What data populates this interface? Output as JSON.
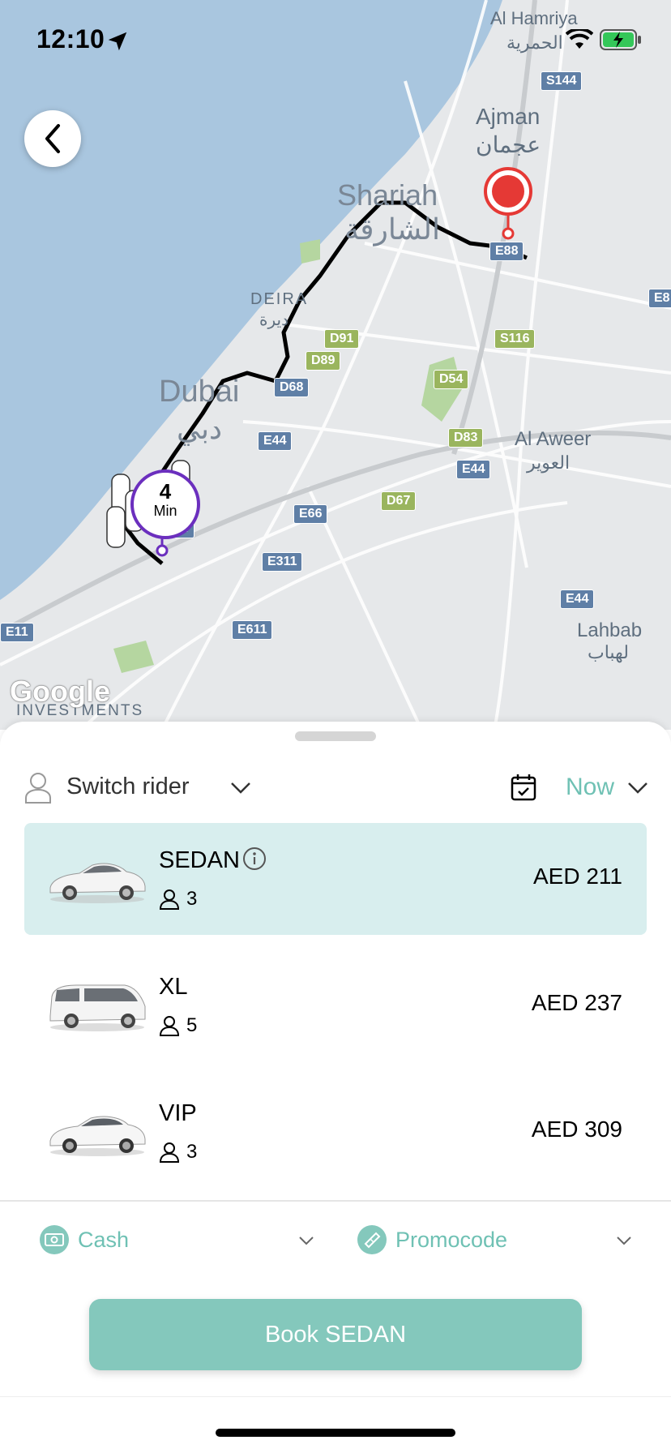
{
  "status_bar": {
    "time": "12:10"
  },
  "map": {
    "labels": {
      "al_hamriya": "Al Hamriya",
      "al_hamriya_ar": "الحمرية",
      "ajman": "Ajman",
      "ajman_ar": "عجمان",
      "sharjah": "Shariah",
      "sharjah_ar": "الشارقة",
      "deira": "DEIRA",
      "deira_ar": "ديرة",
      "dubai": "Dubai",
      "dubai_ar": "دبي",
      "al_aweer": "Al Aweer",
      "al_aweer_ar": "العوير",
      "lahbab": "Lahbab",
      "lahbab_ar": "لهباب",
      "investments": "INVESTMENTS"
    },
    "shields": {
      "s144": "S144",
      "e88": "E88",
      "e88b": "E8",
      "d91": "D91",
      "d89": "D89",
      "s116": "S116",
      "d68": "D68",
      "d54": "D54",
      "d83": "D83",
      "e44a": "E44",
      "e44b": "E44",
      "e66": "E66",
      "d67": "D67",
      "e311": "E311",
      "e44c": "E44",
      "e611": "E611",
      "e11": "E11",
      "e44d": "44"
    },
    "eta": {
      "value": "4",
      "unit": "Min"
    },
    "attribution": "Google"
  },
  "sheet": {
    "switch_rider": "Switch rider",
    "schedule": "Now",
    "vehicles": [
      {
        "name": "SEDAN",
        "passengers": "3",
        "price": "AED 211",
        "selected": true
      },
      {
        "name": "XL",
        "passengers": "5",
        "price": "AED 237",
        "selected": false
      },
      {
        "name": "VIP",
        "passengers": "3",
        "price": "AED 309",
        "selected": false
      }
    ],
    "payment": "Cash",
    "promocode": "Promocode",
    "book_button": "Book SEDAN"
  },
  "colors": {
    "accent": "#6fc1b4",
    "button": "#84c8bc",
    "selected_bg": "#d8eeee",
    "eta_ring": "#6b2fbe",
    "pin": "#e53935"
  }
}
